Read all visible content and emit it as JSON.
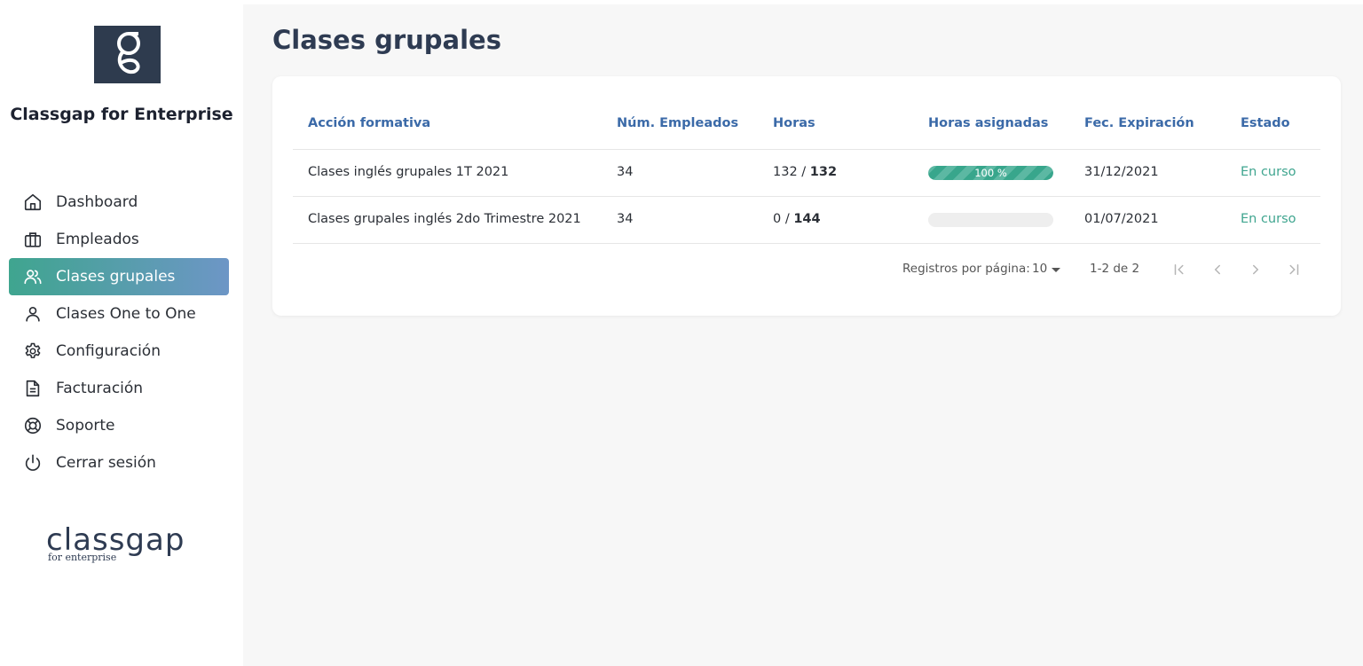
{
  "app": {
    "brand_name": "Classgap for Enterprise",
    "bottom_logo_word": "classgap",
    "bottom_logo_sub": "for enterprise"
  },
  "sidebar": {
    "items": [
      {
        "label": "Dashboard",
        "icon": "home-icon",
        "active": false
      },
      {
        "label": "Empleados",
        "icon": "briefcase-icon",
        "active": false
      },
      {
        "label": "Clases grupales",
        "icon": "users-icon",
        "active": true
      },
      {
        "label": "Clases One to One",
        "icon": "user-icon",
        "active": false
      },
      {
        "label": "Configuración",
        "icon": "gear-icon",
        "active": false
      },
      {
        "label": "Facturación",
        "icon": "document-icon",
        "active": false
      },
      {
        "label": "Soporte",
        "icon": "lifebuoy-icon",
        "active": false
      },
      {
        "label": "Cerrar sesión",
        "icon": "power-icon",
        "active": false
      }
    ]
  },
  "main": {
    "title": "Clases grupales"
  },
  "table": {
    "columns": [
      "Acción formativa",
      "Núm. Empleados",
      "Horas",
      "Horas asignadas",
      "Fec. Expiración",
      "Estado"
    ],
    "rows": [
      {
        "accion": "Clases inglés grupales 1T 2021",
        "empleados": "34",
        "horas_usadas": "132",
        "horas_total": "132",
        "progress_percent": 100,
        "progress_label": "100 %",
        "expiracion": "31/12/2021",
        "estado": "En curso"
      },
      {
        "accion": "Clases grupales inglés 2do Trimestre 2021",
        "empleados": "34",
        "horas_usadas": "0",
        "horas_total": "144",
        "progress_percent": 0,
        "progress_label": "",
        "expiracion": "01/07/2021",
        "estado": "En curso"
      }
    ]
  },
  "pagination": {
    "rows_per_page_label": "Registros por página:",
    "rows_per_page_value": "10",
    "range_text": "1-2 de 2"
  },
  "colors": {
    "accent_green": "#3fa58f",
    "accent_blue": "#3b6aa8",
    "title_dark": "#2e3b52",
    "logo_bg": "#2e3b4e"
  }
}
